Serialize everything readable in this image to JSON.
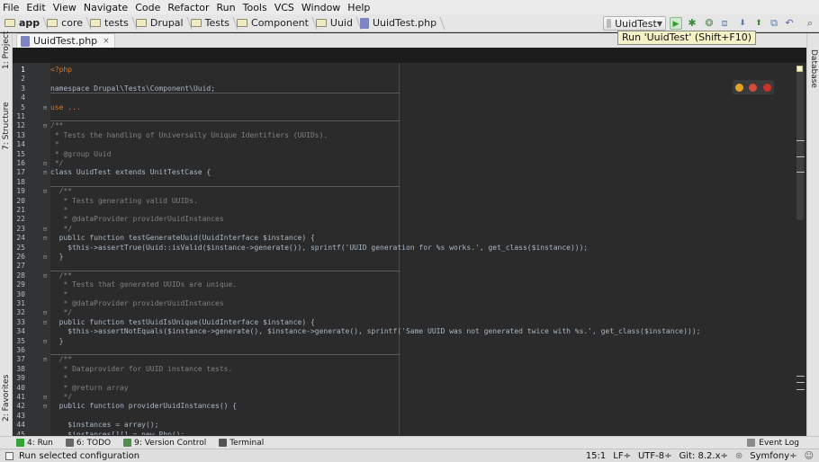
{
  "menu": [
    "File",
    "Edit",
    "View",
    "Navigate",
    "Code",
    "Refactor",
    "Run",
    "Tools",
    "VCS",
    "Window",
    "Help"
  ],
  "breadcrumbs": [
    "app",
    "core",
    "tests",
    "Drupal",
    "Tests",
    "Component",
    "Uuid",
    "UuidTest.php"
  ],
  "run_config": "UuidTest",
  "tooltip": "Run 'UuidTest' (Shift+F10)",
  "tab": {
    "label": "UuidTest.php",
    "close": "×"
  },
  "left_tools": [
    "1: Project",
    "7: Structure",
    "2: Favorites"
  ],
  "right_tools": [
    "Database"
  ],
  "code_lines": [
    {
      "n": "1",
      "t": "<?php",
      "c": "kw"
    },
    {
      "n": "2",
      "t": "",
      "c": ""
    },
    {
      "n": "3",
      "t": "namespace Drupal\\Tests\\Component\\Uuid;",
      "c": ""
    },
    {
      "n": "4",
      "t": "",
      "c": ""
    },
    {
      "n": "5",
      "t": "use ...",
      "c": "kw"
    },
    {
      "n": "11",
      "t": "",
      "c": ""
    },
    {
      "n": "12",
      "t": "/**",
      "c": "cm"
    },
    {
      "n": "13",
      "t": " * Tests the handling of Universally Unique Identifiers (UUIDs).",
      "c": "cm"
    },
    {
      "n": "14",
      "t": " *",
      "c": "cm"
    },
    {
      "n": "15",
      "t": " * @group Uuid",
      "c": "cm"
    },
    {
      "n": "16",
      "t": " */",
      "c": "cm"
    },
    {
      "n": "17",
      "t": "class UuidTest extends UnitTestCase {",
      "c": ""
    },
    {
      "n": "18",
      "t": "",
      "c": ""
    },
    {
      "n": "19",
      "t": "  /**",
      "c": "cm"
    },
    {
      "n": "20",
      "t": "   * Tests generating valid UUIDs.",
      "c": "cm"
    },
    {
      "n": "21",
      "t": "   *",
      "c": "cm"
    },
    {
      "n": "22",
      "t": "   * @dataProvider providerUuidInstances",
      "c": "cm"
    },
    {
      "n": "23",
      "t": "   */",
      "c": "cm"
    },
    {
      "n": "24",
      "t": "  public function testGenerateUuid(UuidInterface $instance) {",
      "c": ""
    },
    {
      "n": "25",
      "t": "    $this->assertTrue(Uuid::isValid($instance->generate()), sprintf('UUID generation for %s works.', get_class($instance)));",
      "c": ""
    },
    {
      "n": "26",
      "t": "  }",
      "c": ""
    },
    {
      "n": "27",
      "t": "",
      "c": ""
    },
    {
      "n": "28",
      "t": "  /**",
      "c": "cm"
    },
    {
      "n": "29",
      "t": "   * Tests that generated UUIDs are unique.",
      "c": "cm"
    },
    {
      "n": "30",
      "t": "   *",
      "c": "cm"
    },
    {
      "n": "31",
      "t": "   * @dataProvider providerUuidInstances",
      "c": "cm"
    },
    {
      "n": "32",
      "t": "   */",
      "c": "cm"
    },
    {
      "n": "33",
      "t": "  public function testUuidIsUnique(UuidInterface $instance) {",
      "c": ""
    },
    {
      "n": "34",
      "t": "    $this->assertNotEquals($instance->generate(), $instance->generate(), sprintf('Same UUID was not generated twice with %s.', get_class($instance)));",
      "c": ""
    },
    {
      "n": "35",
      "t": "  }",
      "c": ""
    },
    {
      "n": "36",
      "t": "",
      "c": ""
    },
    {
      "n": "37",
      "t": "  /**",
      "c": "cm"
    },
    {
      "n": "38",
      "t": "   * Dataprovider for UUID instance tests.",
      "c": "cm"
    },
    {
      "n": "39",
      "t": "   *",
      "c": "cm"
    },
    {
      "n": "40",
      "t": "   * @return array",
      "c": "cm"
    },
    {
      "n": "41",
      "t": "   */",
      "c": "cm"
    },
    {
      "n": "42",
      "t": "  public function providerUuidInstances() {",
      "c": ""
    },
    {
      "n": "43",
      "t": "",
      "c": ""
    },
    {
      "n": "44",
      "t": "    $instances = array();",
      "c": ""
    },
    {
      "n": "45",
      "t": "    $instances[][] = new Php();",
      "c": ""
    }
  ],
  "bottom_tools": [
    {
      "label": "4: Run",
      "icon": "run-icon",
      "color": "#36a336"
    },
    {
      "label": "6: TODO",
      "icon": "todo-icon",
      "color": "#666666"
    },
    {
      "label": "9: Version Control",
      "icon": "vcs-icon",
      "color": "#4f8f4f"
    },
    {
      "label": "Terminal",
      "icon": "terminal-icon",
      "color": "#555555"
    }
  ],
  "event_log": "Event Log",
  "status": {
    "message": "Run selected configuration",
    "position": "15:1",
    "line_sep": "LF÷",
    "encoding": "UTF-8÷",
    "git": "Git: 8.2.x÷",
    "framework": "Symfony÷"
  }
}
